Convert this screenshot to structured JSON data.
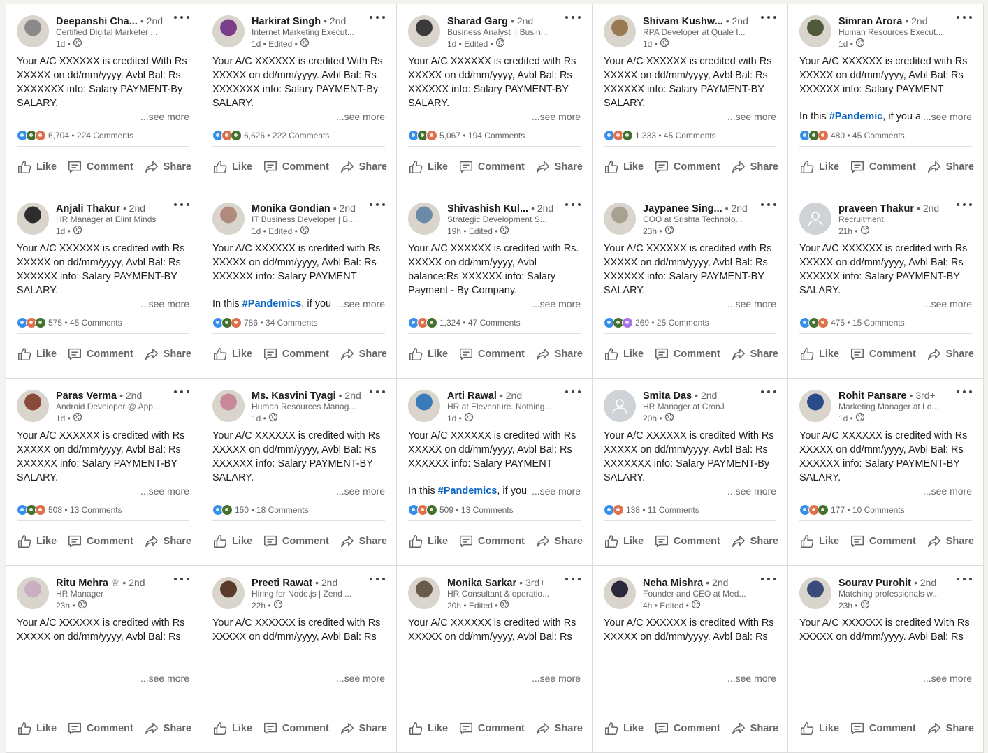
{
  "see_more_label": "...see more",
  "action_labels": {
    "like": "Like",
    "comment": "Comment",
    "share": "Share"
  },
  "posts": [
    {
      "name": "Deepanshi Cha...",
      "degree": "• 2nd",
      "subtitle": "Certified Digital Marketer ...",
      "meta": "1d •",
      "avatar": "photo",
      "avatar_color": "#8a8a8a",
      "text": "Your A/C XXXXXX is credited With Rs XXXXX on dd/mm/yyyy. Avbl Bal: Rs XXXXXXX info: Salary PAYMENT-By SALARY.",
      "tease_prefix": "",
      "tease_tag": "",
      "tease_suffix": "",
      "reactions": [
        "like",
        "celebrate",
        "love"
      ],
      "count": "6,704",
      "comments": "• 224 Comments"
    },
    {
      "name": "Harkirat Singh",
      "degree": "• 2nd",
      "subtitle": "Internet Marketing Execut...",
      "meta": "1d • Edited •",
      "avatar": "photo",
      "avatar_color": "#7a3e8a",
      "text": "Your A/C XXXXXX is credited With Rs XXXXX on dd/mm/yyyy. Avbl Bal: Rs XXXXXXX info: Salary PAYMENT-By SALARY.",
      "tease_prefix": "",
      "tease_tag": "",
      "tease_suffix": "",
      "reactions": [
        "like",
        "love",
        "celebrate"
      ],
      "count": "6,626",
      "comments": "• 222 Comments"
    },
    {
      "name": "Sharad Garg",
      "degree": "• 2nd",
      "subtitle": "Business Analyst || Busin...",
      "meta": "1d • Edited •",
      "avatar": "photo",
      "avatar_color": "#3b3b3b",
      "text": "Your A/C XXXXXX is credited with Rs XXXXX on dd/mm/yyyy, Avbl Bal: Rs XXXXXX info: Salary PAYMENT-BY SALARY.",
      "tease_prefix": "",
      "tease_tag": "",
      "tease_suffix": "",
      "reactions": [
        "like",
        "celebrate",
        "love"
      ],
      "count": "5,067",
      "comments": "• 194 Comments"
    },
    {
      "name": "Shivam Kushw...",
      "degree": "• 2nd",
      "subtitle": "RPA Developer at Quale I...",
      "meta": "1d •",
      "avatar": "photo",
      "avatar_color": "#9a7a52",
      "text": "Your A/C XXXXXX is credited with Rs XXXXX on dd/mm/yyyy, Avbl Bal: Rs XXXXXX info: Salary PAYMENT-BY SALARY.",
      "tease_prefix": "",
      "tease_tag": "",
      "tease_suffix": "",
      "reactions": [
        "like",
        "love",
        "celebrate"
      ],
      "count": "1,333",
      "comments": "• 45 Comments"
    },
    {
      "name": "Simran Arora",
      "degree": "• 2nd",
      "subtitle": "Human Resources Execut...",
      "meta": "1d •",
      "avatar": "photo",
      "avatar_color": "#4f5a3a",
      "text": "Your A/C XXXXXX is credited with Rs XXXXX on dd/mm/yyyy, Avbl Bal: Rs XXXXXX info: Salary PAYMENT",
      "tease_prefix": "In this ",
      "tease_tag": "#Pandemic",
      "tease_suffix": ", if you a",
      "reactions": [
        "like",
        "celebrate",
        "love"
      ],
      "count": "480",
      "comments": "• 45 Comments"
    },
    {
      "name": "Anjali Thakur",
      "degree": "• 2nd",
      "subtitle": "HR Manager at Elint Minds",
      "meta": "1d •",
      "avatar": "photo",
      "avatar_color": "#2d2d2d",
      "text": "Your A/C XXXXXX is credited with Rs XXXXX on dd/mm/yyyy, Avbl Bal: Rs XXXXXX info: Salary PAYMENT-BY SALARY.",
      "tease_prefix": "",
      "tease_tag": "",
      "tease_suffix": "",
      "reactions": [
        "like",
        "love",
        "celebrate"
      ],
      "count": "575",
      "comments": "• 45 Comments"
    },
    {
      "name": "Monika Gondian",
      "degree": "• 2nd",
      "subtitle": "IT Business Developer | B...",
      "meta": "1d • Edited •",
      "avatar": "photo",
      "avatar_color": "#b08a7a",
      "text": "Your A/C XXXXXX is credited with Rs XXXXX on dd/mm/yyyy, Avbl Bal: Rs XXXXXX info: Salary PAYMENT",
      "tease_prefix": "In this ",
      "tease_tag": "#Pandemics",
      "tease_suffix": ", if you",
      "reactions": [
        "like",
        "celebrate",
        "love"
      ],
      "count": "786",
      "comments": "• 34 Comments"
    },
    {
      "name": "Shivashish Kul...",
      "degree": "• 2nd",
      "subtitle": "Strategic Development S...",
      "meta": "19h • Edited •",
      "avatar": "photo",
      "avatar_color": "#6a8aa8",
      "text": "Your A/C XXXXXX is credited with Rs. XXXXX on dd/mm/yyyy, Avbl balance:Rs XXXXXX info: Salary Payment - By Company.",
      "tease_prefix": "",
      "tease_tag": "",
      "tease_suffix": "",
      "reactions": [
        "like",
        "love",
        "celebrate"
      ],
      "count": "1,324",
      "comments": "• 47 Comments"
    },
    {
      "name": "Jaypanee Sing...",
      "degree": "• 2nd",
      "subtitle": "COO at Srishta Technolo...",
      "meta": "23h •",
      "avatar": "photo",
      "avatar_color": "#a8a090",
      "text": "Your A/C XXXXXX is credited with Rs XXXXX on dd/mm/yyyy, Avbl Bal: Rs XXXXXX info: Salary PAYMENT-BY SALARY.",
      "tease_prefix": "",
      "tease_tag": "",
      "tease_suffix": "",
      "reactions": [
        "like",
        "celebrate",
        "curious"
      ],
      "count": "269",
      "comments": "• 25 Comments"
    },
    {
      "name": "praveen Thakur",
      "degree": "• 2nd",
      "subtitle": "Recruitment",
      "meta": "21h •",
      "avatar": "placeholder",
      "avatar_color": "#cfd2d6",
      "text": "Your A/C XXXXXX is credited with Rs XXXXX on dd/mm/yyyy, Avbl Bal: Rs XXXXXX info: Salary PAYMENT-BY SALARY.",
      "tease_prefix": "",
      "tease_tag": "",
      "tease_suffix": "",
      "reactions": [
        "like",
        "celebrate",
        "love"
      ],
      "count": "475",
      "comments": "• 15 Comments"
    },
    {
      "name": "Paras Verma",
      "degree": "• 2nd",
      "subtitle": "Android Developer @ App...",
      "meta": "1d •",
      "avatar": "photo",
      "avatar_color": "#8a4a3a",
      "text": "Your A/C XXXXXX is credited with Rs XXXXX on dd/mm/yyyy, Avbl Bal: Rs XXXXXX info: Salary PAYMENT-BY SALARY.",
      "tease_prefix": "",
      "tease_tag": "",
      "tease_suffix": "",
      "reactions": [
        "like",
        "celebrate",
        "love"
      ],
      "count": "508",
      "comments": "• 13 Comments"
    },
    {
      "name": "Ms. Kasvini Tyagi",
      "degree": "• 2nd",
      "subtitle": "Human Resources Manag...",
      "meta": "1d •",
      "avatar": "photo",
      "avatar_color": "#c88a9a",
      "text": "Your A/C XXXXXX is credited with Rs XXXXX on dd/mm/yyyy, Avbl Bal: Rs XXXXXX info: Salary PAYMENT-BY SALARY.",
      "tease_prefix": "",
      "tease_tag": "",
      "tease_suffix": "",
      "reactions": [
        "like",
        "celebrate"
      ],
      "count": "150",
      "comments": "• 18 Comments"
    },
    {
      "name": "Arti Rawal",
      "degree": "• 2nd",
      "subtitle": "HR at Eleventure. Nothing...",
      "meta": "1d •",
      "avatar": "photo",
      "avatar_color": "#3a7ab8",
      "text": "Your A/C XXXXXX is credited with Rs XXXXX on dd/mm/yyyy, Avbl Bal: Rs XXXXXX info: Salary PAYMENT",
      "tease_prefix": "In this ",
      "tease_tag": "#Pandemics",
      "tease_suffix": ", if you",
      "reactions": [
        "like",
        "love",
        "celebrate"
      ],
      "count": "509",
      "comments": "• 13 Comments"
    },
    {
      "name": "Smita Das",
      "degree": "• 2nd",
      "subtitle": "HR Manager at CronJ",
      "meta": "20h •",
      "avatar": "placeholder",
      "avatar_color": "#cfd2d6",
      "text": "Your A/C XXXXXX is credited With Rs XXXXX on dd/mm/yyyy. Avbl Bal: Rs XXXXXXX info: Salary PAYMENT-By SALARY.",
      "tease_prefix": "",
      "tease_tag": "",
      "tease_suffix": "",
      "reactions": [
        "like",
        "love"
      ],
      "count": "138",
      "comments": "• 11 Comments"
    },
    {
      "name": "Rohit Pansare",
      "degree": "• 3rd+",
      "subtitle": "Marketing Manager at Lo...",
      "meta": "1d •",
      "avatar": "photo",
      "avatar_color": "#2a4a8a",
      "text": "Your A/C XXXXXX is credited with Rs XXXXX on dd/mm/yyyy, Avbl Bal: Rs XXXXXX info: Salary PAYMENT-BY SALARY.",
      "tease_prefix": "",
      "tease_tag": "",
      "tease_suffix": "",
      "reactions": [
        "like",
        "love",
        "celebrate"
      ],
      "count": "177",
      "comments": "• 10 Comments"
    },
    {
      "name": "Ritu Mehra",
      "degree": "♕ • 2nd",
      "subtitle": "HR Manager",
      "meta": "23h •",
      "avatar": "photo",
      "avatar_color": "#c8b0c0",
      "text": "Your A/C XXXXXX is credited with Rs XXXXX on dd/mm/yyyy, Avbl Bal: Rs",
      "tease_prefix": "",
      "tease_tag": "",
      "tease_suffix": "",
      "reactions": [],
      "count": "",
      "comments": ""
    },
    {
      "name": "Preeti Rawat",
      "degree": "• 2nd",
      "subtitle": "Hiring for Node.js | Zend ...",
      "meta": "22h •",
      "avatar": "photo",
      "avatar_color": "#5a3a2a",
      "text": "Your A/C XXXXXX is credited with Rs XXXXX on dd/mm/yyyy, Avbl Bal: Rs",
      "tease_prefix": "",
      "tease_tag": "",
      "tease_suffix": "",
      "reactions": [],
      "count": "",
      "comments": ""
    },
    {
      "name": "Monika Sarkar",
      "degree": "• 3rd+",
      "subtitle": "HR Consultant & operatio...",
      "meta": "20h • Edited •",
      "avatar": "photo",
      "avatar_color": "#6a5a4a",
      "text": "Your A/C XXXXXX is credited with Rs XXXXX on dd/mm/yyyy, Avbl Bal: Rs",
      "tease_prefix": "",
      "tease_tag": "",
      "tease_suffix": "",
      "reactions": [],
      "count": "",
      "comments": ""
    },
    {
      "name": "Neha Mishra",
      "degree": "• 2nd",
      "subtitle": "Founder and CEO at Med...",
      "meta": "4h • Edited •",
      "avatar": "photo",
      "avatar_color": "#2a2a3a",
      "text": "Your A/C XXXXXX is credited With Rs XXXXX on dd/mm/yyyy. Avbl Bal: Rs",
      "tease_prefix": "",
      "tease_tag": "",
      "tease_suffix": "",
      "reactions": [],
      "count": "",
      "comments": ""
    },
    {
      "name": "Sourav Purohit",
      "degree": "• 2nd",
      "subtitle": "Matching professionals w...",
      "meta": "23h •",
      "avatar": "photo",
      "avatar_color": "#3a4a7a",
      "text": "Your A/C XXXXXX is credited With Rs XXXXX on dd/mm/yyyy. Avbl Bal: Rs",
      "tease_prefix": "",
      "tease_tag": "",
      "tease_suffix": "",
      "reactions": [],
      "count": "",
      "comments": ""
    }
  ]
}
